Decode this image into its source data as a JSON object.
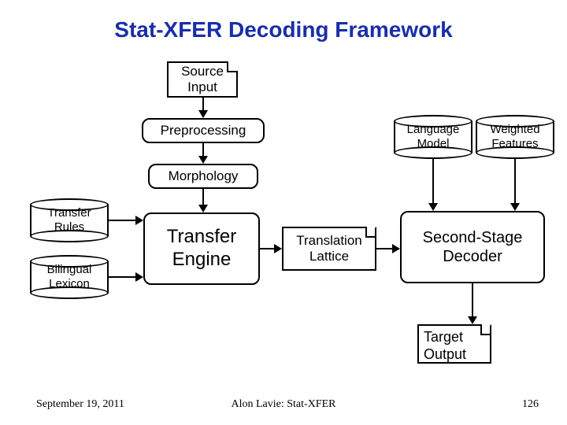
{
  "title": "Stat-XFER Decoding Framework",
  "nodes": {
    "source_input": "Source\nInput",
    "preprocessing": "Preprocessing",
    "morphology": "Morphology",
    "transfer_rules": "Transfer\nRules",
    "bilingual_lexicon": "Bilingual\nLexicon",
    "transfer_engine": "Transfer\nEngine",
    "translation_lattice": "Translation\nLattice",
    "language_model": "Language\nModel",
    "weighted_features": "Weighted\nFeatures",
    "second_stage_decoder": "Second-Stage\nDecoder",
    "target_output": "Target\nOutput"
  },
  "footer": {
    "left": "September 19, 2011",
    "center": "Alon Lavie: Stat-XFER",
    "right": "126"
  }
}
